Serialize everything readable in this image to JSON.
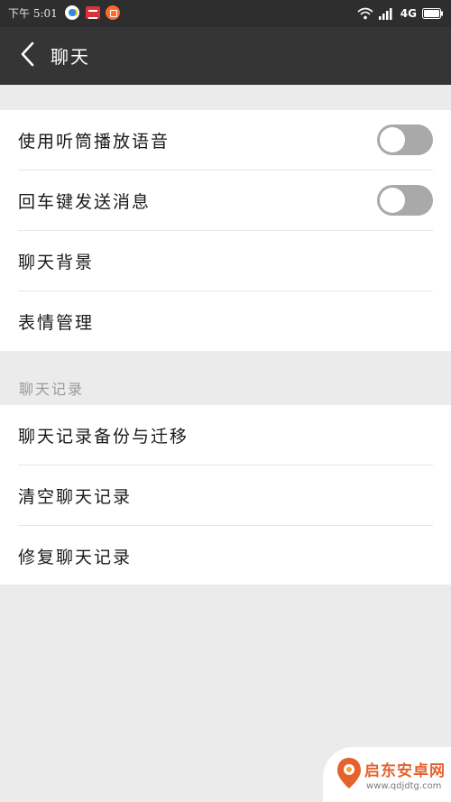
{
  "status_bar": {
    "time": "下午 5:01",
    "network": "4G"
  },
  "nav": {
    "title": "聊天",
    "back_icon": "chevron-left-icon"
  },
  "settings_group_1": [
    {
      "label": "使用听筒播放语音",
      "toggle": true,
      "toggle_on": false
    },
    {
      "label": "回车键发送消息",
      "toggle": true,
      "toggle_on": false
    },
    {
      "label": "聊天背景",
      "toggle": false
    },
    {
      "label": "表情管理",
      "toggle": false
    }
  ],
  "section_header": "聊天记录",
  "settings_group_2": [
    {
      "label": "聊天记录备份与迁移"
    },
    {
      "label": "清空聊天记录"
    },
    {
      "label": "修复聊天记录"
    }
  ],
  "watermark": {
    "name": "启东安卓网",
    "url": "www.qdjdtg.com"
  },
  "colors": {
    "nav_background": "#353535",
    "status_background": "#2e2e2e",
    "toggle_off": "#a9a9a9",
    "page_background": "#ebebeb",
    "watermark_accent": "#e4622e"
  }
}
